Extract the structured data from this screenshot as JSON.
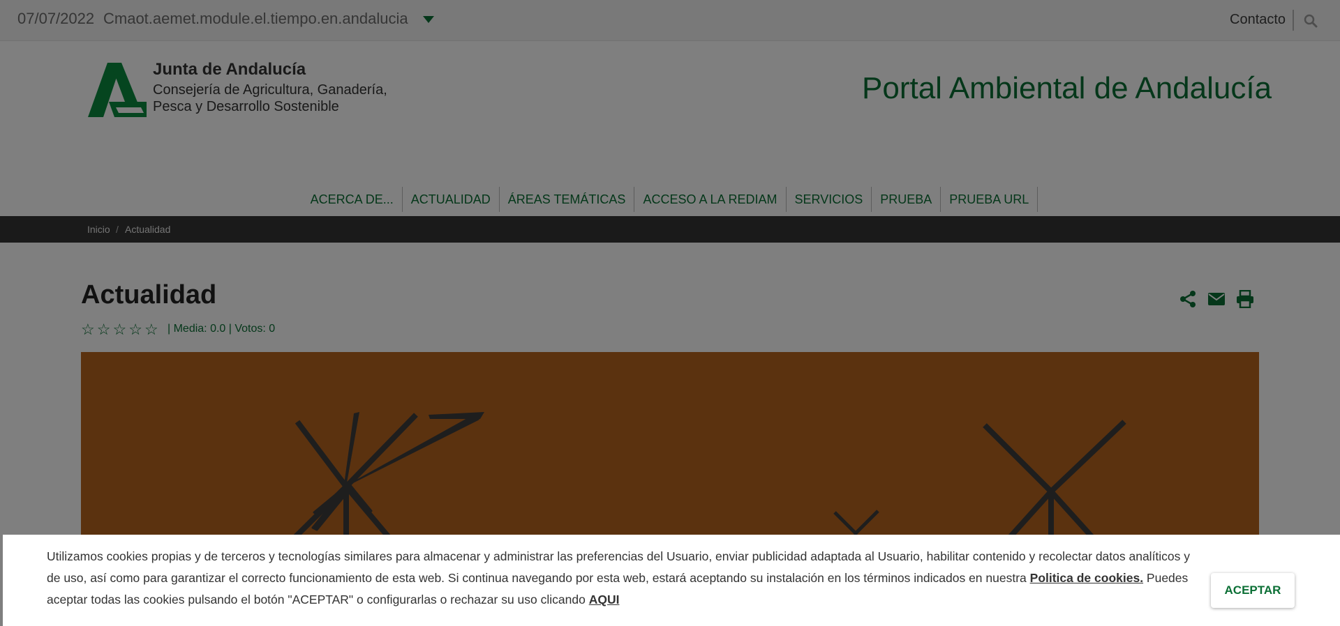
{
  "topbar": {
    "date": "07/07/2022",
    "module": "Cmaot.aemet.module.el.tiempo.en.andalucia",
    "contact": "Contacto"
  },
  "header": {
    "org_title": "Junta de Andalucía",
    "org_sub_line1": "Consejería de Agricultura, Ganadería,",
    "org_sub_line2": "Pesca y Desarrollo Sostenible",
    "portal_title": "Portal Ambiental de Andalucía"
  },
  "nav": {
    "items": [
      {
        "label": "ACERCA DE..."
      },
      {
        "label": "ACTUALIDAD"
      },
      {
        "label": "ÁREAS TEMÁTICAS"
      },
      {
        "label": "ACCESO A LA REDIAM"
      },
      {
        "label": "SERVICIOS"
      },
      {
        "label": "PRUEBA"
      },
      {
        "label": "PRUEBA URL"
      }
    ]
  },
  "breadcrumb": {
    "home": "Inicio",
    "separator": "/",
    "current": "Actualidad"
  },
  "main": {
    "title": "Actualidad",
    "rating": {
      "stars_filled": 0,
      "stars_total": 5,
      "text": "| Media: 0.0 | Votos: 0"
    }
  },
  "cookie": {
    "text_before": "Utilizamos cookies propias y de terceros y tecnologías similares para almacenar y administrar las preferencias del Usuario, enviar publicidad adaptada al Usuario, habilitar contenido y recolectar datos analíticos y de uso, así como para garantizar el correcto funcionamiento de esta web. Si continua navegando por esta web, estará aceptando su instalación en los términos indicados en nuestra ",
    "policy_link": "Politica de cookies.",
    "text_after": " Puedes aceptar todas las cookies pulsando el botón \"ACEPTAR\" o configurarlas o rechazar su uso clicando ",
    "here_link": "AQUI",
    "accept_label": "ACEPTAR"
  },
  "colors": {
    "brand_green": "#0b6f35",
    "breadcrumb_bg": "#353535",
    "hero_bg": "#b7651f"
  },
  "icons": [
    "chevron-down-icon",
    "search-icon",
    "share-icon",
    "mail-icon",
    "print-icon",
    "star-icon",
    "junta-logo"
  ]
}
